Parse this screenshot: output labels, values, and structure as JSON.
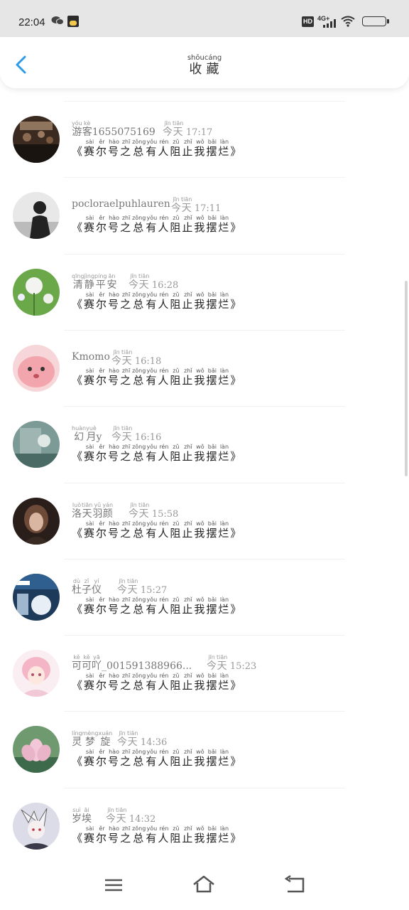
{
  "status_bar": {
    "time": "22:04",
    "icons": [
      "wechat-icon",
      "app-notification-icon",
      "hd-icon",
      "signal-4g-icon",
      "wifi-icon",
      "battery-icon"
    ],
    "hd_label": "HD",
    "network_label": "4G+"
  },
  "header": {
    "title_chars": [
      "收",
      "藏"
    ],
    "title_pinyin": [
      "shōu",
      "cáng"
    ],
    "back_icon": "chevron-left-icon",
    "accent_color": "#2f9be8"
  },
  "message": {
    "open_quote": "《",
    "close_quote": "》",
    "chars": [
      "赛",
      "尔",
      "号",
      "之",
      "总",
      "有",
      "人",
      "阻",
      "止",
      "我",
      "摆",
      "烂"
    ],
    "pinyin": [
      "sài",
      "ěr",
      "hào",
      "zhī",
      "zǒng",
      "yǒu",
      "rén",
      "zǔ",
      "zhǐ",
      "wǒ",
      "bǎi",
      "làn"
    ]
  },
  "items": [
    {
      "name_parts": [
        {
          "t": "游",
          "p": "yóu"
        },
        {
          "t": "客",
          "p": "kè"
        },
        {
          "t": "1655075169",
          "p": ""
        }
      ],
      "day": "今天",
      "day_pinyin": [
        "jīn",
        "tiān"
      ],
      "time": "17:17"
    },
    {
      "name_parts": [
        {
          "t": "pocloraelpuhlauren",
          "p": ""
        }
      ],
      "day": "今天",
      "day_pinyin": [
        "jīn",
        "tiān"
      ],
      "time": "17:11"
    },
    {
      "name_parts": [
        {
          "t": "清",
          "p": "qīng"
        },
        {
          "t": "静",
          "p": "jìng"
        },
        {
          "t": "平",
          "p": "píng"
        },
        {
          "t": "安",
          "p": "ān"
        }
      ],
      "day": "今天",
      "day_pinyin": [
        "jīn",
        "tiān"
      ],
      "time": "16:28"
    },
    {
      "name_parts": [
        {
          "t": "Kmomo",
          "p": ""
        }
      ],
      "day": "今天",
      "day_pinyin": [
        "jīn",
        "tiān"
      ],
      "time": "16:18"
    },
    {
      "name_parts": [
        {
          "t": "幻",
          "p": "huàn"
        },
        {
          "t": "月",
          "p": "yuè"
        },
        {
          "t": "y",
          "p": ""
        }
      ],
      "day": "今天",
      "day_pinyin": [
        "jīn",
        "tiān"
      ],
      "time": "16:16"
    },
    {
      "name_parts": [
        {
          "t": "洛",
          "p": "luò"
        },
        {
          "t": "天",
          "p": "tiān"
        },
        {
          "t": "羽",
          "p": "yǔ"
        },
        {
          "t": "颜",
          "p": "yán"
        }
      ],
      "day": "今天",
      "day_pinyin": [
        "jīn",
        "tiān"
      ],
      "time": "15:58"
    },
    {
      "name_parts": [
        {
          "t": "杜",
          "p": "dù"
        },
        {
          "t": "子",
          "p": "zǐ"
        },
        {
          "t": "仪",
          "p": "yí"
        }
      ],
      "day": "今天",
      "day_pinyin": [
        "jīn",
        "tiān"
      ],
      "time": "15:27"
    },
    {
      "name_parts": [
        {
          "t": "可",
          "p": "kě"
        },
        {
          "t": "可",
          "p": "kě"
        },
        {
          "t": "吖",
          "p": "yā"
        },
        {
          "t": "_001591388966...",
          "p": ""
        }
      ],
      "day": "今天",
      "day_pinyin": [
        "jīn",
        "tiān"
      ],
      "time": "15:23"
    },
    {
      "name_parts": [
        {
          "t": "灵",
          "p": "líng"
        },
        {
          "t": "梦",
          "p": "mèng"
        },
        {
          "t": "旋",
          "p": "xuán"
        }
      ],
      "day": "今天",
      "day_pinyin": [
        "jīn",
        "tiān"
      ],
      "time": "14:36"
    },
    {
      "name_parts": [
        {
          "t": "岁",
          "p": "suì"
        },
        {
          "t": "埃",
          "p": "āi"
        }
      ],
      "day": "今天",
      "day_pinyin": [
        "jīn",
        "tiān"
      ],
      "time": "14:32"
    }
  ],
  "nav_bar": {
    "buttons": [
      "menu-icon",
      "home-icon",
      "back-icon"
    ]
  }
}
